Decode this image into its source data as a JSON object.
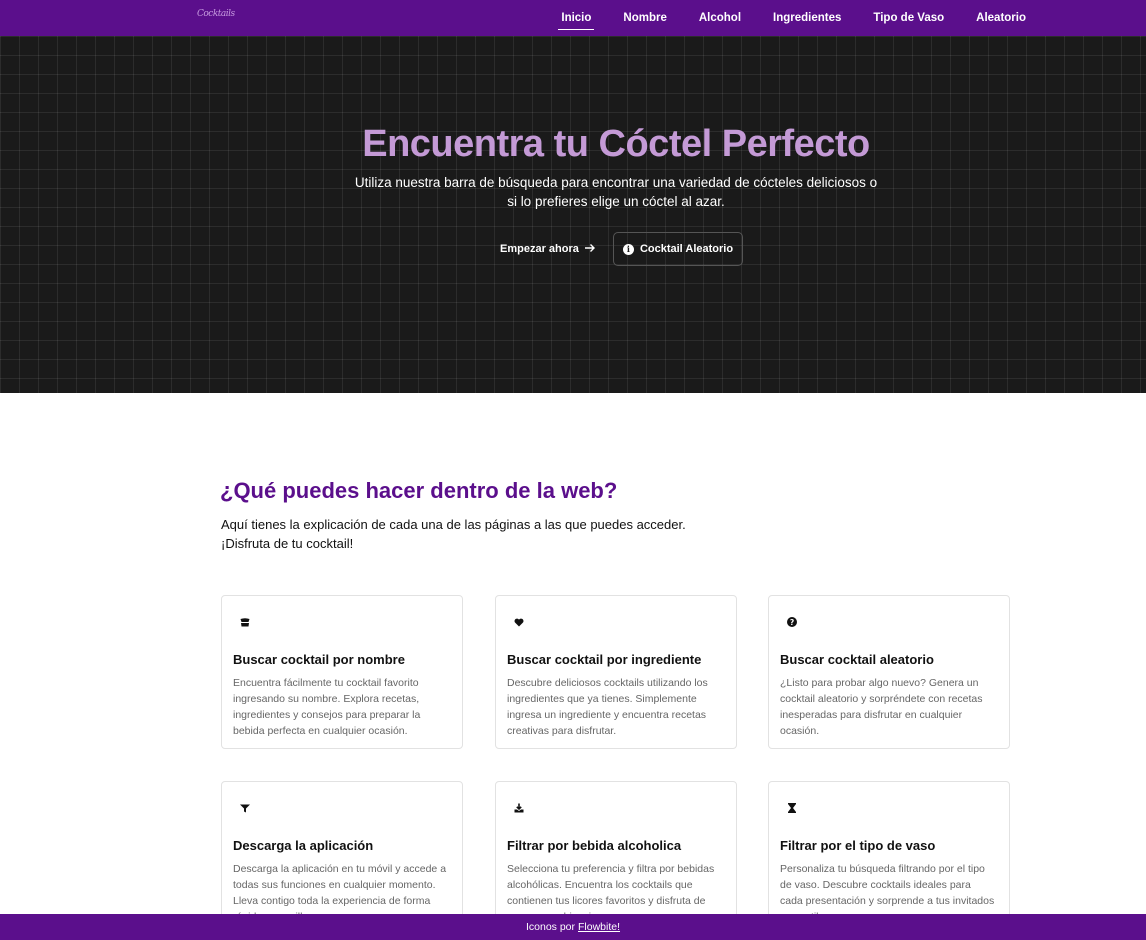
{
  "navbar": {
    "logo": "Cocktails",
    "links": [
      "Inicio",
      "Nombre",
      "Alcohol",
      "Ingredientes",
      "Tipo de Vaso",
      "Aleatorio"
    ]
  },
  "hero": {
    "title": "Encuentra tu Cóctel Perfecto",
    "subtitle": "Utiliza nuestra barra de búsqueda para encontrar una variedad de cócteles deliciosos o si lo prefieres elige un cóctel al azar.",
    "start_label": "Empezar ahora",
    "random_label": "Cocktail Aleatorio"
  },
  "intro": {
    "title": "¿Qué puedes hacer dentro de la web?",
    "line1": "Aquí tienes la explicación de cada una de las páginas a las que puedes acceder.",
    "line2": "¡Disfruta de tu cocktail!"
  },
  "cards": [
    {
      "icon": "cocktail-glass-icon",
      "title": "Buscar cocktail por nombre",
      "text": "Encuentra fácilmente tu cocktail favorito ingresando su nombre. Explora recetas, ingredientes y consejos para preparar la bebida perfecta en cualquier ocasión."
    },
    {
      "icon": "heart-icon",
      "title": "Buscar cocktail por ingrediente",
      "text": "Descubre deliciosos cocktails utilizando los ingredientes que ya tienes. Simplemente ingresa un ingrediente y encuentra recetas creativas para disfrutar."
    },
    {
      "icon": "question-circle-icon",
      "title": "Buscar cocktail aleatorio",
      "text": "¿Listo para probar algo nuevo? Genera un cocktail aleatorio y sorpréndete con recetas inesperadas para disfrutar en cualquier ocasión."
    },
    {
      "icon": "filter-icon",
      "title": "Descarga la aplicación",
      "text": "Descarga la aplicación en tu móvil y accede a todas sus funciones en cualquier momento. Lleva contigo toda la experiencia de forma rápida y sencilla."
    },
    {
      "icon": "download-icon",
      "title": "Filtrar por bebida alcoholica",
      "text": "Selecciona tu preferencia y filtra por bebidas alcohólicas. Encuentra los cocktails que contienen tus licores favoritos y disfruta de nuevas combinaciones."
    },
    {
      "icon": "hourglass-icon",
      "title": "Filtrar por el tipo de vaso",
      "text": "Personaliza tu búsqueda filtrando por el tipo de vaso. Descubre cocktails ideales para cada presentación y sorprende a tus invitados con estilo."
    }
  ],
  "footer": {
    "text": "Iconos por",
    "link": "Flowbite!"
  },
  "colors": {
    "primary": "#5b0f8c",
    "hero_bg": "#1a1a1a",
    "hero_title": "#c49ad6"
  }
}
